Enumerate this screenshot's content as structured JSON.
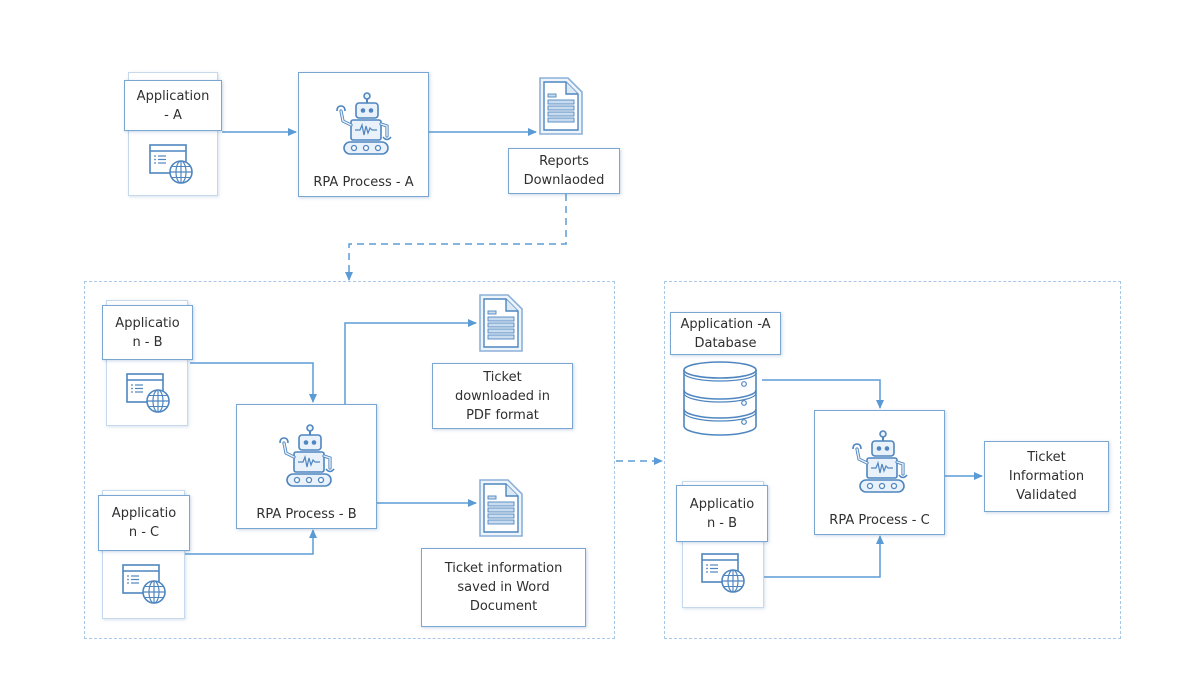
{
  "diagram": {
    "colors": {
      "line": "#5b9bd5",
      "border": "#7aa6d2",
      "group_border": "#a9c8e8"
    },
    "top_row": {
      "app_a": {
        "label": "Application\n- A",
        "icon": "web-application-icon"
      },
      "rpa_a": {
        "label": "RPA Process - A",
        "icon": "robot-icon"
      },
      "reports": {
        "label": "Reports\nDownlaoded",
        "icon": "document-icon"
      }
    },
    "group_b": {
      "app_b": {
        "label": "Applicatio\nn - B",
        "icon": "web-application-icon"
      },
      "app_c": {
        "label": "Applicatio\nn - C",
        "icon": "web-application-icon"
      },
      "rpa_b": {
        "label": "RPA Process - B",
        "icon": "robot-icon"
      },
      "pdf_output": {
        "label": "Ticket\ndownloaded in\nPDF format",
        "icon": "document-icon"
      },
      "word_output": {
        "label": "Ticket information\nsaved in Word\nDocument",
        "icon": "document-icon"
      }
    },
    "group_c": {
      "database": {
        "label": "Application -A\nDatabase",
        "icon": "database-icon"
      },
      "app_b": {
        "label": "Applicatio\nn - B",
        "icon": "web-application-icon"
      },
      "rpa_c": {
        "label": "RPA Process - C",
        "icon": "robot-icon"
      },
      "validated": {
        "label": "Ticket\nInformation\nValidated"
      }
    },
    "connectors": [
      {
        "from": "app_a",
        "to": "rpa_a",
        "style": "solid"
      },
      {
        "from": "rpa_a",
        "to": "reports",
        "style": "solid"
      },
      {
        "from": "reports",
        "to": "group_b",
        "style": "dashed"
      },
      {
        "from": "app_b",
        "to": "rpa_b",
        "style": "solid"
      },
      {
        "from": "app_c",
        "to": "rpa_b",
        "style": "solid"
      },
      {
        "from": "rpa_b",
        "to": "pdf_output",
        "style": "solid"
      },
      {
        "from": "rpa_b",
        "to": "word_output",
        "style": "solid"
      },
      {
        "from": "group_b",
        "to": "group_c",
        "style": "dashed"
      },
      {
        "from": "database",
        "to": "rpa_c",
        "style": "solid"
      },
      {
        "from": "group_c.app_b",
        "to": "rpa_c",
        "style": "solid"
      },
      {
        "from": "rpa_c",
        "to": "validated",
        "style": "solid"
      }
    ]
  }
}
